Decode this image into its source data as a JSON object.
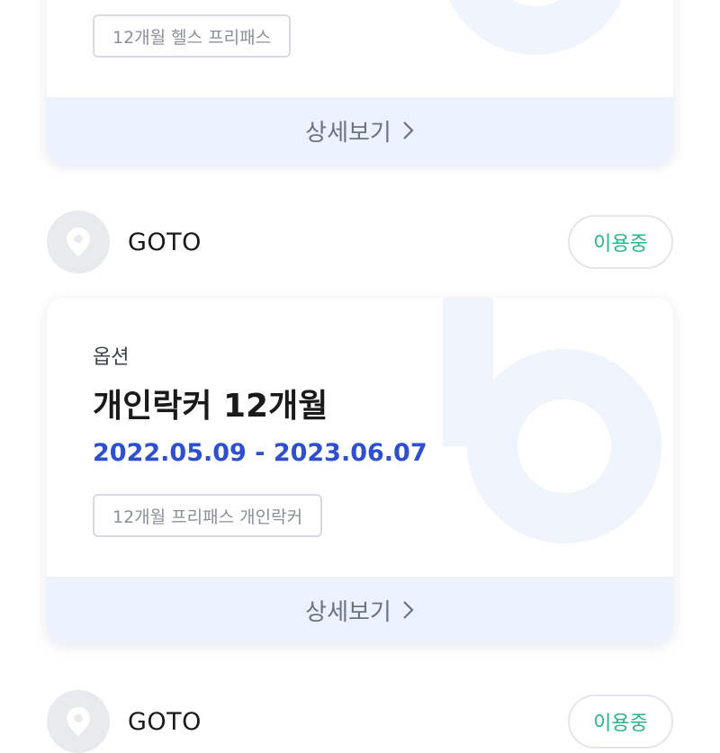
{
  "cards": [
    {
      "tag": "12개월 헬스 프리패스",
      "detail_label": "상세보기"
    },
    {
      "option_label": "옵션",
      "title": "개인락커 12개월",
      "dates": "2022.05.09 - 2023.06.07",
      "tag": "12개월 프리패스 개인락커",
      "detail_label": "상세보기"
    }
  ],
  "gyms": [
    {
      "name": "GOTO",
      "status": "이용중"
    },
    {
      "name": "GOTO",
      "status": "이용중"
    }
  ],
  "colors": {
    "accent_blue": "#2d4fd0",
    "status_green": "#2bb38a",
    "detail_bg": "#ecf3fe",
    "watermark": "#f0f4fc"
  },
  "icons": {
    "location": "location-pin-icon",
    "chevron": "chevron-right-icon",
    "watermark": "brand-watermark-icon"
  }
}
